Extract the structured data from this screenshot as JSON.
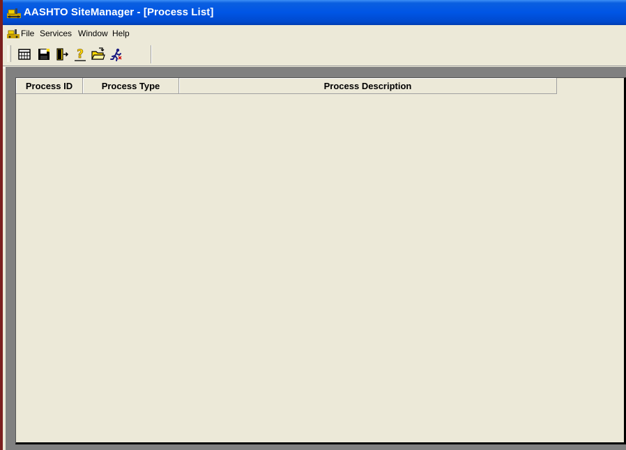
{
  "window": {
    "title": "AASHTO SiteManager - [Process List]",
    "app_icon": "sitemanager-app-icon"
  },
  "menubar": {
    "items": [
      {
        "label": "File"
      },
      {
        "label": "Services"
      },
      {
        "label": "Window"
      },
      {
        "label": "Help"
      }
    ]
  },
  "toolbar": {
    "buttons": [
      {
        "icon": "list-grid-icon"
      },
      {
        "icon": "save-disk-icon"
      },
      {
        "icon": "exit-door-icon"
      },
      {
        "icon": "help-question-icon"
      },
      {
        "icon": "open-folder-icon"
      },
      {
        "icon": "run-process-icon"
      }
    ]
  },
  "process_list": {
    "columns": [
      {
        "label": "Process ID"
      },
      {
        "label": "Process Type"
      },
      {
        "label": "Process Description"
      }
    ],
    "rows": []
  },
  "colors": {
    "titlebar": "#0055e5",
    "chrome": "#ece9d8",
    "mdi_background": "#808080"
  }
}
